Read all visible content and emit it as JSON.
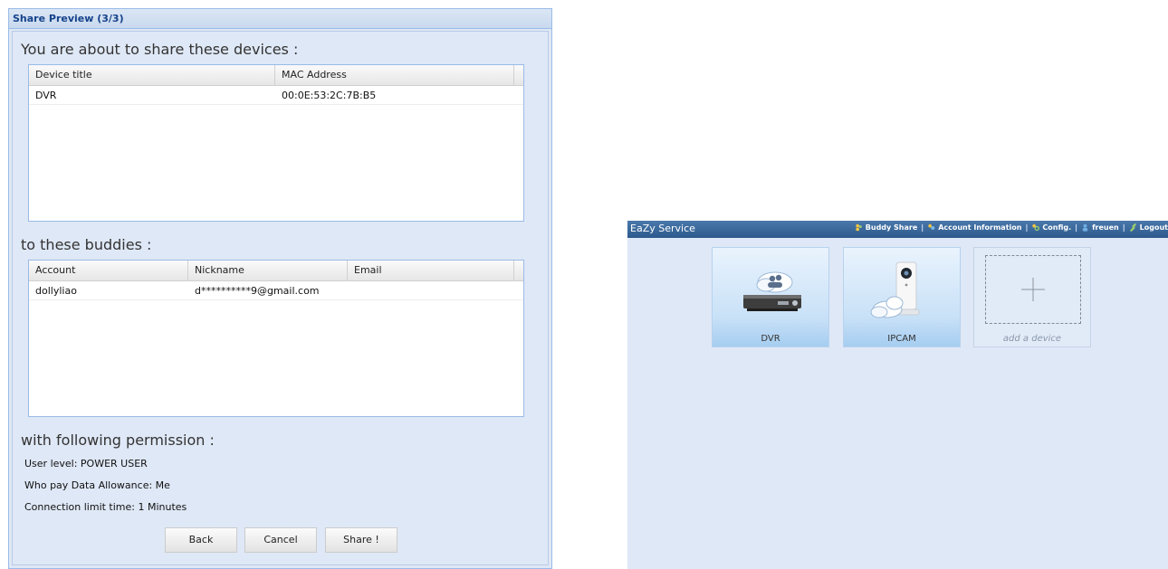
{
  "dialog": {
    "title": "Share Preview (3/3)",
    "devices_heading": "You are about to share these devices :",
    "devices_columns": [
      "Device title",
      "MAC Address"
    ],
    "devices_rows": [
      {
        "title": "DVR",
        "mac": "00:0E:53:2C:7B:B5"
      }
    ],
    "buddies_heading": "to these buddies :",
    "buddies_columns": [
      "Account",
      "Nickname",
      "Email"
    ],
    "buddies_rows": [
      {
        "account": "dollyliao",
        "nickname": "d**********9@gmail.com",
        "email": ""
      }
    ],
    "permission_heading": "with following permission :",
    "permissions": {
      "user_level": "User level: POWER USER",
      "data_allowance": "Who pay Data Allowance: Me",
      "connection_limit": "Connection limit time: 1 Minutes"
    },
    "buttons": {
      "back": "Back",
      "cancel": "Cancel",
      "share": "Share !"
    }
  },
  "service": {
    "brand": "EaZy Service",
    "nav": {
      "buddy_share": "Buddy Share",
      "account_info": "Account Information",
      "config": "Config.",
      "user": "freuen",
      "logout": "Logout"
    },
    "separator": "|",
    "tiles": {
      "dvr": "DVR",
      "ipcam": "IPCAM",
      "add": "add a device"
    },
    "colors": {
      "topbar": "#2c5a8c",
      "background": "#dfe8f6"
    }
  }
}
